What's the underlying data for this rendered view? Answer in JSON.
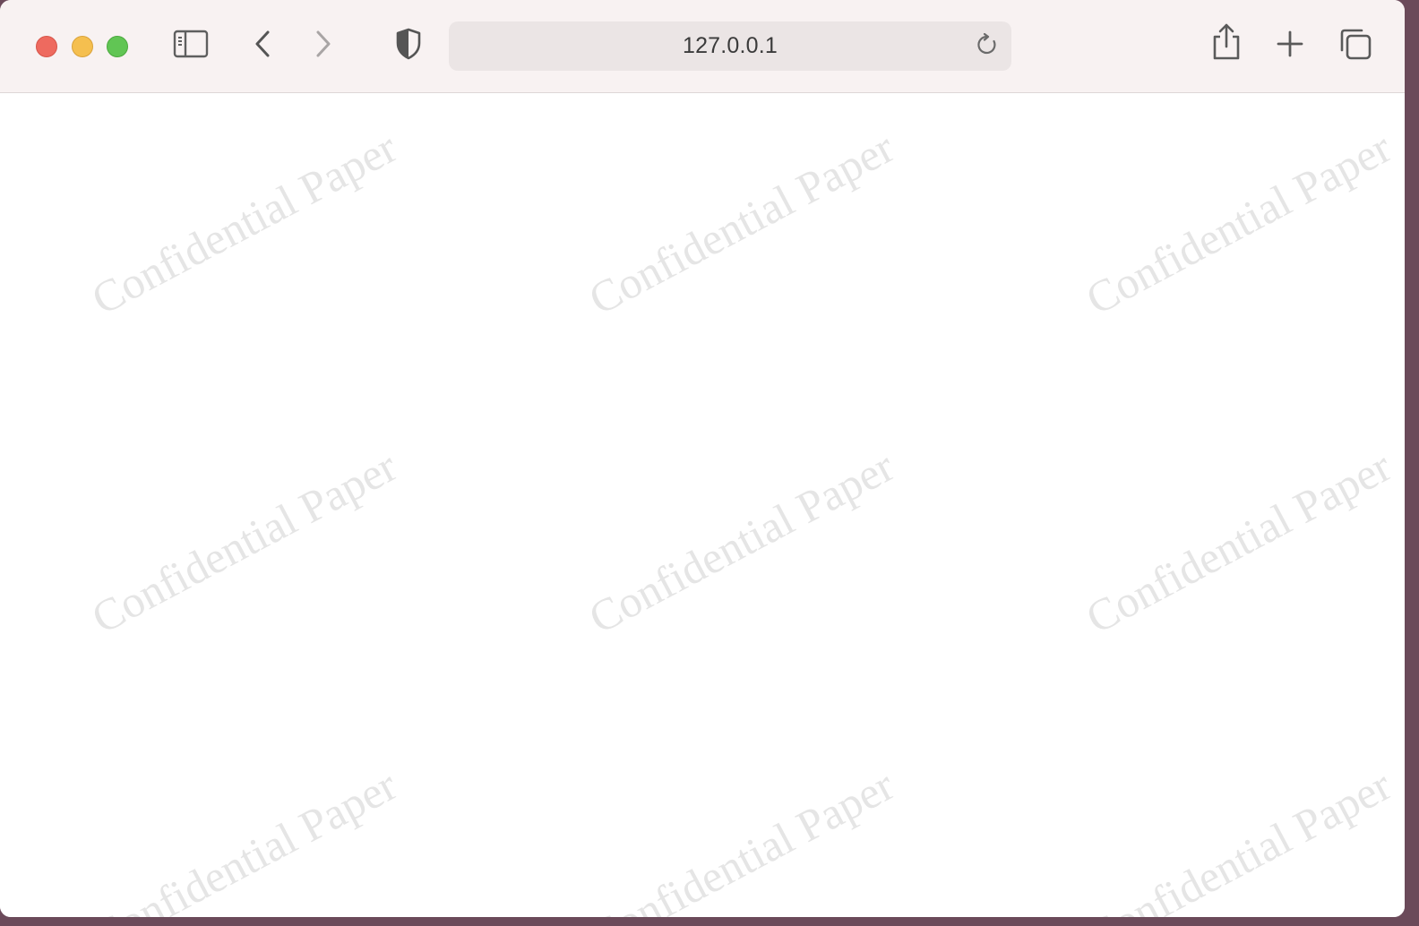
{
  "browser": {
    "address_bar": {
      "url": "127.0.0.1"
    },
    "icons": {
      "sidebar": "sidebar-icon",
      "back": "chevron-left-icon",
      "forward": "chevron-right-icon",
      "privacy": "shield-icon",
      "reload": "reload-icon",
      "share": "share-icon",
      "new_tab": "plus-icon",
      "tab_overview": "tab-overview-icon"
    },
    "colors": {
      "toolbar_bg": "#f8f2f2",
      "close": "#ee6a5f",
      "minimize": "#f5bf4f",
      "maximize": "#61c554"
    }
  },
  "page": {
    "watermark_text": "Confidential Paper",
    "watermarks": [
      "Confidential Paper",
      "Confidential Paper",
      "Confidential Paper",
      "Confidential Paper",
      "Confidential Paper",
      "Confidential Paper",
      "Confidential Paper",
      "Confidential Paper",
      "Confidential Paper"
    ]
  }
}
